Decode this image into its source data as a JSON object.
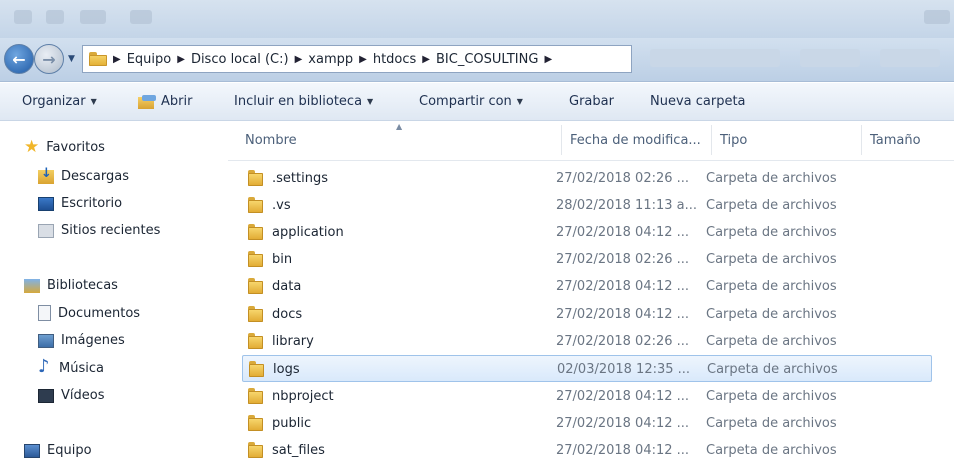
{
  "breadcrumb": [
    "Equipo",
    "Disco local (C:)",
    "xampp",
    "htdocs",
    "BIC_COSULTING"
  ],
  "toolbar": {
    "organize": "Organizar",
    "open": "Abrir",
    "include": "Incluir en biblioteca",
    "share": "Compartir con",
    "burn": "Grabar",
    "new_folder": "Nueva carpeta"
  },
  "sidebar": {
    "favorites": "Favoritos",
    "favorite_items": [
      "Descargas",
      "Escritorio",
      "Sitios recientes"
    ],
    "libraries": "Bibliotecas",
    "library_items": [
      "Documentos",
      "Imágenes",
      "Música",
      "Vídeos"
    ],
    "computer": "Equipo"
  },
  "columns": {
    "name": "Nombre",
    "date": "Fecha de modifica...",
    "type": "Tipo",
    "size": "Tamaño"
  },
  "files": [
    {
      "name": ".settings",
      "date": "27/02/2018 02:26 ...",
      "type": "Carpeta de archivos"
    },
    {
      "name": ".vs",
      "date": "28/02/2018 11:13 a...",
      "type": "Carpeta de archivos"
    },
    {
      "name": "application",
      "date": "27/02/2018 04:12 ...",
      "type": "Carpeta de archivos"
    },
    {
      "name": "bin",
      "date": "27/02/2018 02:26 ...",
      "type": "Carpeta de archivos"
    },
    {
      "name": "data",
      "date": "27/02/2018 04:12 ...",
      "type": "Carpeta de archivos"
    },
    {
      "name": "docs",
      "date": "27/02/2018 04:12 ...",
      "type": "Carpeta de archivos"
    },
    {
      "name": "library",
      "date": "27/02/2018 02:26 ...",
      "type": "Carpeta de archivos"
    },
    {
      "name": "logs",
      "date": "02/03/2018 12:35 ...",
      "type": "Carpeta de archivos",
      "selected": true
    },
    {
      "name": "nbproject",
      "date": "27/02/2018 04:12 ...",
      "type": "Carpeta de archivos"
    },
    {
      "name": "public",
      "date": "27/02/2018 04:12 ...",
      "type": "Carpeta de archivos"
    },
    {
      "name": "sat_files",
      "date": "27/02/2018 04:12 ...",
      "type": "Carpeta de archivos"
    }
  ],
  "icons": {
    "back": "back-arrow-icon",
    "forward": "forward-arrow-icon",
    "folder": "folder-icon",
    "favorites": "star-icon"
  },
  "colors": {
    "selection_bg": "#d9e9fb",
    "selection_border": "#9fc3ea",
    "folder_yellow": "#f9da72"
  }
}
